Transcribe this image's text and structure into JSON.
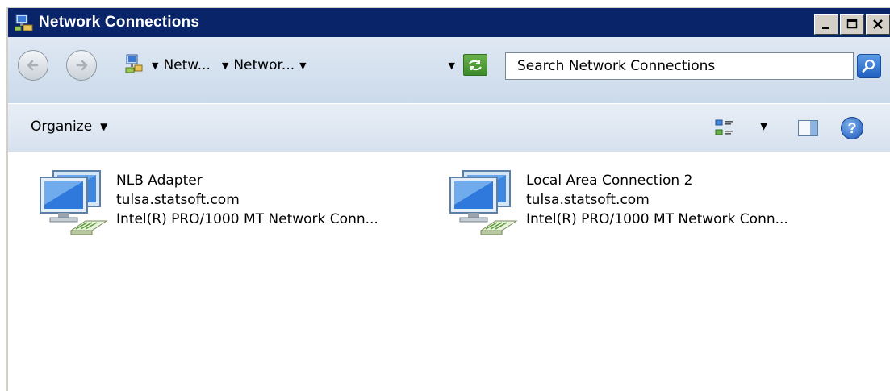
{
  "window": {
    "title": "Network Connections",
    "controls": {
      "minimize": "_",
      "maximize": "□",
      "close": "X"
    }
  },
  "address_bar": {
    "breadcrumbs": [
      "Netw...",
      "Networ..."
    ],
    "search_placeholder": "Search Network Connections",
    "icons": {
      "back": "back-arrow-icon",
      "forward": "forward-arrow-icon",
      "location": "network-connections-icon",
      "refresh": "refresh-icon",
      "search": "magnifier-icon"
    }
  },
  "command_bar": {
    "organize_label": "Organize",
    "icons": {
      "views": "change-view-icon",
      "preview_pane": "preview-pane-icon",
      "help": "help-icon"
    },
    "help_glyph": "?"
  },
  "connections": [
    {
      "name": "NLB Adapter",
      "network": "tulsa.statsoft.com",
      "device": "Intel(R) PRO/1000 MT Network Conn..."
    },
    {
      "name": "Local Area Connection 2",
      "network": "tulsa.statsoft.com",
      "device": "Intel(R) PRO/1000 MT Network Conn..."
    }
  ],
  "colors": {
    "titlebar": "#0a246a",
    "address_bar": "#d8e3ef",
    "refresh": "#4f9a38",
    "search_button": "#2f6fd0"
  }
}
